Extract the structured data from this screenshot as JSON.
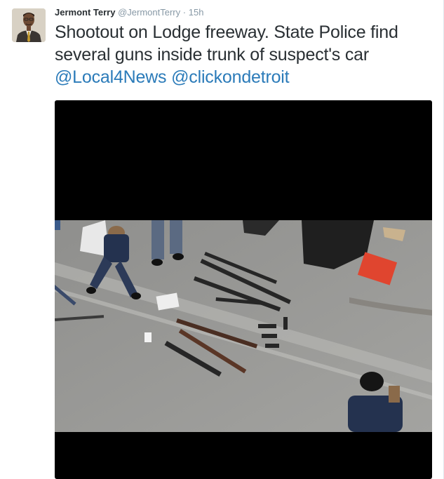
{
  "tweet": {
    "author_name": "Jermont Terry",
    "handle": "@JermontTerry",
    "separator": "·",
    "time": "15h",
    "text_plain": "Shootout on Lodge freeway. State Police find several guns inside trunk of suspect's car ",
    "mention_1": "@Local4News",
    "mention_2": "@clickondetroit"
  },
  "colors": {
    "link": "#2b7bb9",
    "text": "#292f33",
    "muted": "#8899a6"
  },
  "icons": {
    "avatar": "person-portrait"
  }
}
